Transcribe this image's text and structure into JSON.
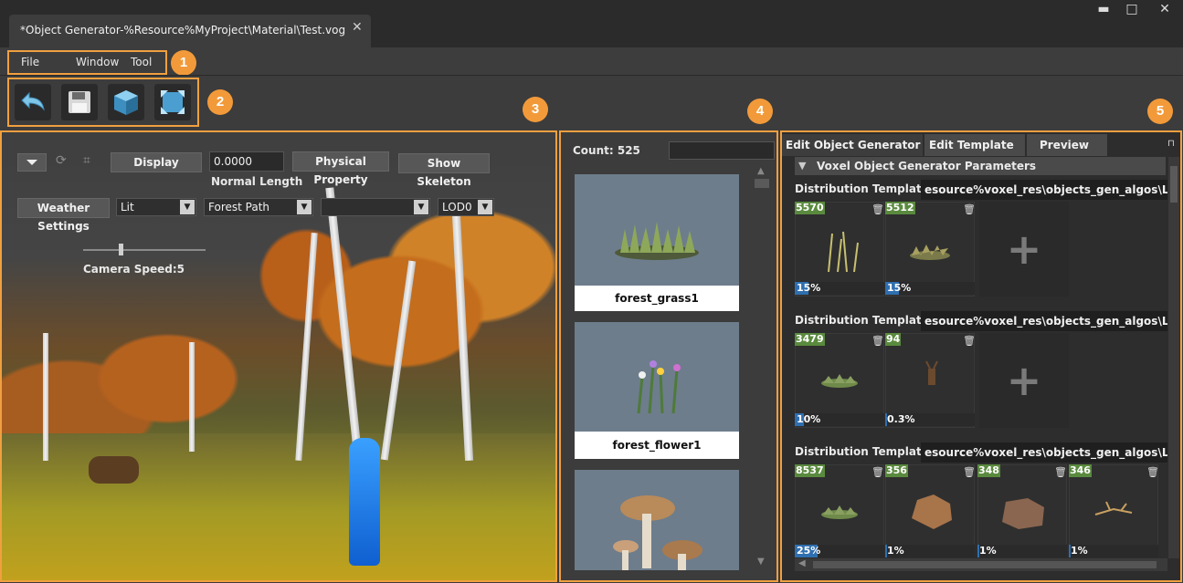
{
  "window": {
    "tab_title": "*Object Generator-%Resource%MyProject\\Material\\Test.vog",
    "close_glyph": "✕",
    "buttons": [
      "▬",
      "□",
      "✕"
    ]
  },
  "menu": {
    "items": [
      "File",
      "Window",
      "Tool"
    ]
  },
  "callouts": [
    "1",
    "2",
    "3",
    "4",
    "5"
  ],
  "toolbar": {
    "icons": [
      "undo-icon",
      "save-icon",
      "cube-icon",
      "fit-view-icon"
    ]
  },
  "viewport": {
    "display_label": "Display",
    "value_input": "0.0000",
    "normal_length_label": "Normal Length",
    "physical_property_label": "Physical Property",
    "show_skeleton_label": "Show Skeleton",
    "weather_settings_label": "Weather Settings",
    "lit_option": "Lit",
    "forest_path_option": "Forest Path",
    "empty_option": "",
    "lod_option": "LOD0",
    "camera_speed_label": "Camera Speed:5",
    "camera_speed_level": 0.3
  },
  "asset_list": {
    "count_label": "Count: 525",
    "search_value": "",
    "items": [
      {
        "name": "forest_grass1"
      },
      {
        "name": "forest_flower1"
      },
      {
        "name": ""
      }
    ]
  },
  "right_panel": {
    "tabs": [
      "Edit Object Generator",
      "Edit Template",
      "Preview"
    ],
    "section_title": "Voxel Object Generator Parameters",
    "distribution_label": "Distribution Template",
    "templates": [
      {
        "path": "esource%voxel_res\\objects_gen_algos\\Level_",
        "cells": [
          {
            "count": "5570",
            "percent": "15%",
            "fill": 0.15
          },
          {
            "count": "5512",
            "percent": "15%",
            "fill": 0.15
          }
        ]
      },
      {
        "path": "esource%voxel_res\\objects_gen_algos\\Level_",
        "cells": [
          {
            "count": "3479",
            "percent": "10%",
            "fill": 0.1
          },
          {
            "count": "94",
            "percent": "0.3%",
            "fill": 0.003
          }
        ]
      },
      {
        "path": "esource%voxel_res\\objects_gen_algos\\Level_",
        "cells": [
          {
            "count": "8537",
            "percent": "25%",
            "fill": 0.25
          },
          {
            "count": "356",
            "percent": "1%",
            "fill": 0.01
          },
          {
            "count": "348",
            "percent": "1%",
            "fill": 0.01
          },
          {
            "count": "346",
            "percent": "1%",
            "fill": 0.01
          }
        ]
      }
    ],
    "add_glyph": "+",
    "trash_glyph": "🗑",
    "collapse_glyph": "▼"
  },
  "colors": {
    "callout": "#f29a3a",
    "count_badge": "#5a8a3e",
    "percent_fill": "#2f6fb0"
  }
}
